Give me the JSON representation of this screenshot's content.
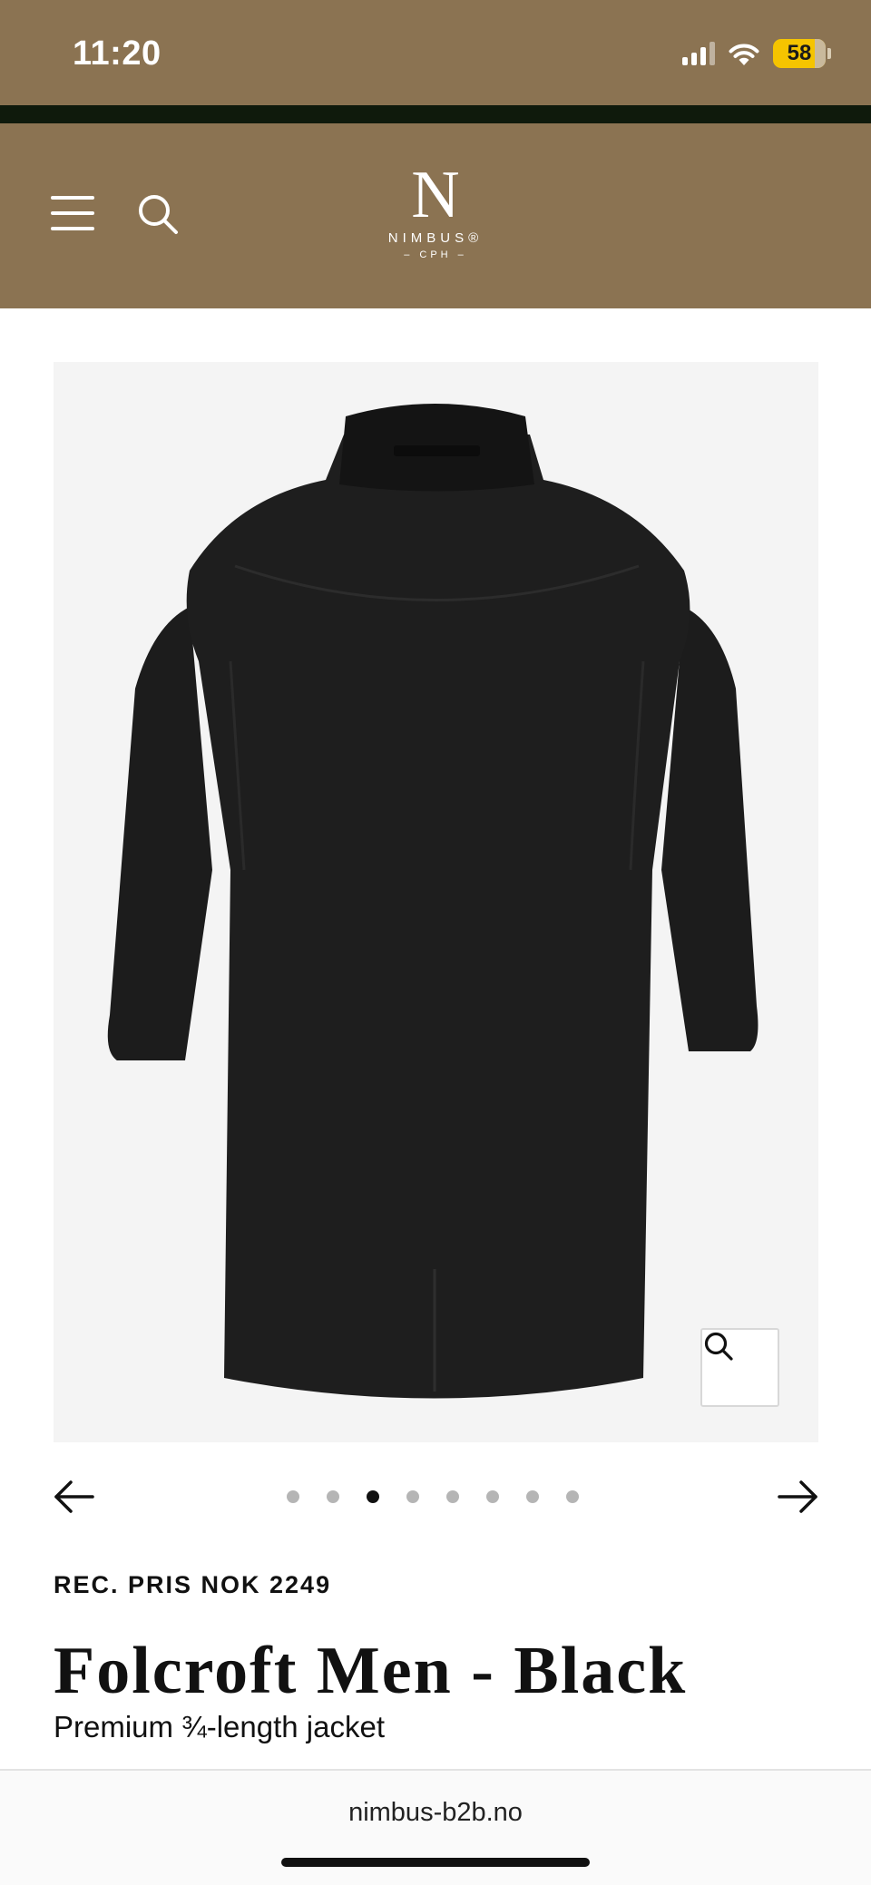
{
  "status_bar": {
    "time": "11:20",
    "battery_level": "58",
    "battery_fraction": 0.58,
    "signal_bars": 4,
    "wifi_icon": "wifi-icon"
  },
  "header": {
    "background_color": "#8b7352",
    "menu_icon": "hamburger-menu-icon",
    "search_icon": "search-icon",
    "logo": {
      "letter": "N",
      "name": "NIMBUS®",
      "sub": "– CPH –"
    }
  },
  "product": {
    "image": "black-jacket-back-view",
    "zoom_icon": "zoom-search-icon",
    "carousel": {
      "total_images": 8,
      "active_index": 3,
      "prev_icon": "arrow-left-icon",
      "next_icon": "arrow-right-icon"
    },
    "price": "REC. PRIS NOK 2249",
    "title": "Folcroft Men - Black",
    "subtitle": "Premium ¾-length jacket"
  },
  "browser": {
    "url": "nimbus-b2b.no"
  }
}
